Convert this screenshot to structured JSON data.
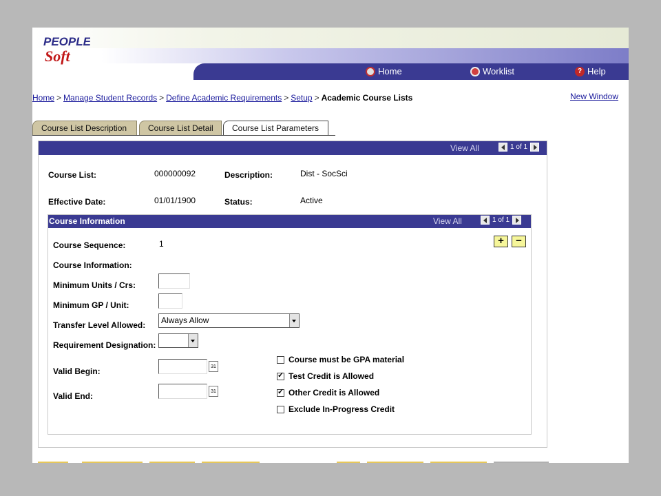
{
  "header": {
    "logo_text_top": "PEOPLE",
    "logo_text_bottom": "Soft",
    "nav": [
      {
        "label": "Home",
        "icon": "home-icon"
      },
      {
        "label": "Worklist",
        "icon": "worklist-icon"
      },
      {
        "label": "Help",
        "icon": "help-icon"
      }
    ]
  },
  "breadcrumb": {
    "links": [
      "Home",
      "Manage Student Records",
      "Define Academic Requirements",
      "Setup"
    ],
    "separator": ">",
    "current": "Academic Course Lists"
  },
  "new_window": "New Window",
  "tabs": [
    {
      "label": "Course List Description",
      "active": false
    },
    {
      "label": "Course List Detail",
      "active": false
    },
    {
      "label": "Course List Parameters",
      "active": true
    }
  ],
  "main": {
    "view_all": "View All",
    "pager": "1 of 1",
    "course_list_label": "Course List:",
    "course_list_value": "000000092",
    "description_label": "Description:",
    "description_value": "Dist - SocSci",
    "effective_date_label": "Effective Date:",
    "effective_date_value": "01/01/1900",
    "status_label": "Status:",
    "status_value": "Active"
  },
  "course_info": {
    "title": "Course Information",
    "view_all": "View All",
    "pager": "1 of 1",
    "sequence_label": "Course Sequence:",
    "sequence_value": "1",
    "info_label": "Course Information:",
    "min_units_label": "Minimum Units / Crs:",
    "min_units_value": "",
    "min_gp_label": "Minimum GP / Unit:",
    "min_gp_value": "",
    "transfer_label": "Transfer Level Allowed:",
    "transfer_value": "Always Allow",
    "designation_label": "Requirement Designation:",
    "designation_value": "",
    "valid_begin_label": "Valid Begin:",
    "valid_end_label": "Valid End:",
    "calendar_icon_text": "31",
    "add_label": "+",
    "remove_label": "−",
    "checkboxes": [
      {
        "label": "Course must be GPA material",
        "checked": false
      },
      {
        "label": "Test Credit is Allowed",
        "checked": true
      },
      {
        "label": "Other Credit is Allowed",
        "checked": true
      },
      {
        "label": "Exclude In-Progress Credit",
        "checked": false
      }
    ]
  },
  "colors": {
    "nav_bar": "#3a3a92",
    "link": "#1a1a9c",
    "tab_inactive": "#cfc6a4",
    "button_yellow": "#f6f69a"
  }
}
